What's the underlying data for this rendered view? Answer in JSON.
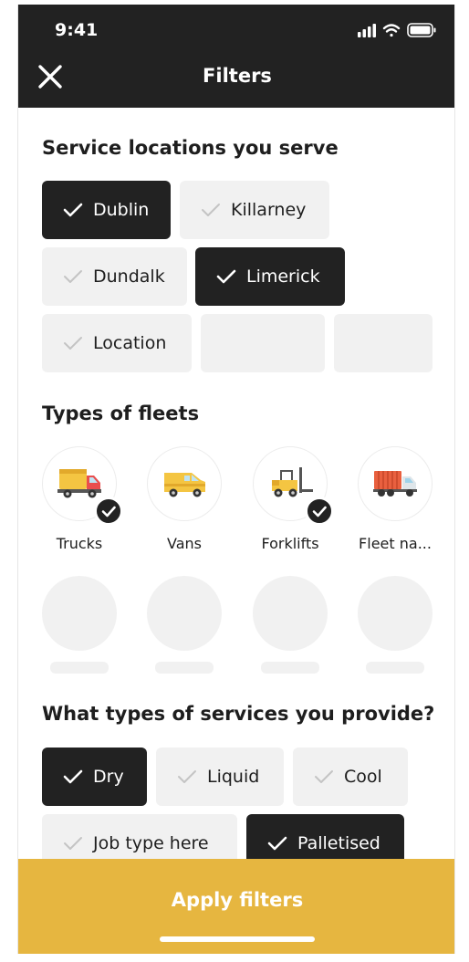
{
  "status": {
    "time": "9:41"
  },
  "header": {
    "title": "Filters",
    "close_icon": "close-icon"
  },
  "locations": {
    "title": "Service locations you serve",
    "chips": [
      {
        "label": "Dublin",
        "selected": true
      },
      {
        "label": "Killarney",
        "selected": false
      },
      {
        "label": "Dundalk",
        "selected": false
      },
      {
        "label": "Limerick",
        "selected": true
      },
      {
        "label": "Location",
        "selected": false
      }
    ]
  },
  "fleets": {
    "title": "Types of fleets",
    "items": [
      {
        "label": "Trucks",
        "icon": "truck-icon",
        "selected": true
      },
      {
        "label": "Vans",
        "icon": "van-icon",
        "selected": false
      },
      {
        "label": "Forklifts",
        "icon": "forklift-icon",
        "selected": true
      },
      {
        "label": "Fleet na...",
        "icon": "trailer-truck-icon",
        "selected": false
      }
    ]
  },
  "services": {
    "title": "What types of services you provide?",
    "chips": [
      {
        "label": "Dry",
        "selected": true
      },
      {
        "label": "Liquid",
        "selected": false
      },
      {
        "label": "Cool",
        "selected": false
      },
      {
        "label": "Job type here",
        "selected": false
      },
      {
        "label": "Palletised",
        "selected": true
      }
    ]
  },
  "apply": {
    "label": "Apply filters"
  },
  "colors": {
    "dark": "#222222",
    "chip": "#f1f1f1",
    "accent": "#e6b640"
  }
}
